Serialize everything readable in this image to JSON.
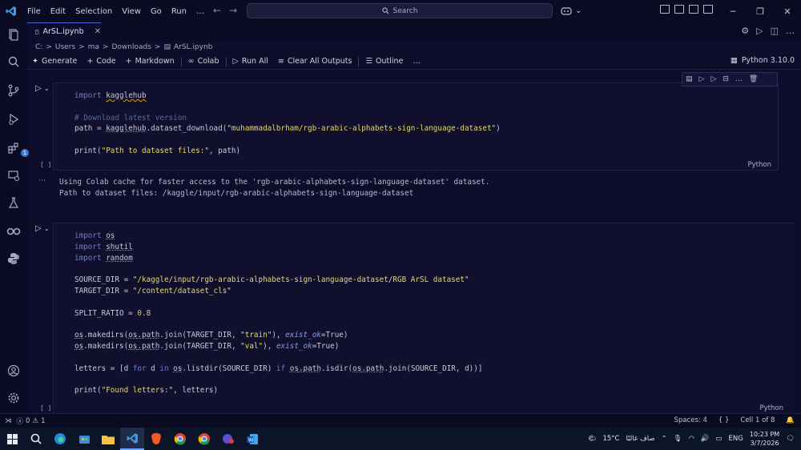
{
  "menu": [
    "File",
    "Edit",
    "Selection",
    "View",
    "Go",
    "Run",
    "…"
  ],
  "search": {
    "label": "Search"
  },
  "tab": {
    "title": "ArSL.ipynb"
  },
  "breadcrumb": [
    "C:",
    ">",
    "Users",
    ">",
    "ma",
    ">",
    "Downloads",
    ">",
    "ArSL.ipynb"
  ],
  "toolbar": {
    "generate": "Generate",
    "code": "Code",
    "markdown": "Markdown",
    "colab": "Colab",
    "run_all": "Run All",
    "clear_outputs": "Clear All Outputs",
    "outline": "Outline",
    "more": "…",
    "kernel": "Python 3.10.0"
  },
  "cell1": {
    "exec": "[ ]",
    "lang": "Python",
    "lines": {
      "l1_kw": "import",
      "l1_mod": "kagglehub",
      "l3": "# Download latest version",
      "l4_pre": "path = ",
      "l4_mod": "kagglehub",
      "l4_fn": ".dataset_download(",
      "l4_str": "\"muhammadalbrham/rgb-arabic-alphabets-sign-language-dataset\"",
      "l4_end": ")",
      "l6_fn": "print(",
      "l6_str": "\"Path to dataset files:\"",
      "l6_end": ", path)"
    }
  },
  "output1": {
    "line1": "Using Colab cache for faster access to the 'rgb-arabic-alphabets-sign-language-dataset' dataset.",
    "line2": "Path to dataset files: /kaggle/input/rgb-arabic-alphabets-sign-language-dataset"
  },
  "cell2": {
    "exec": "[ ]",
    "lang": "Python",
    "lines": {
      "i1": "os",
      "i2": "shutil",
      "i3": "random",
      "kw": "import",
      "src_pre": "SOURCE_DIR = ",
      "src_str": "\"/kaggle/input/rgb-arabic-alphabets-sign-language-dataset/RGB ArSL dataset\"",
      "tgt_pre": "TARGET_DIR = ",
      "tgt_str": "\"/content/dataset_cls\"",
      "split_pre": "SPLIT_RATIO = ",
      "split_num": "0.8",
      "mk1_os": "os",
      "mk1_mid": ".makedirs(",
      "mk1_os2": "os",
      "mk1_path": ".path",
      "mk1_join": ".join(TARGET_DIR, ",
      "mk1_str": "\"train\"",
      "mk1_sep": "), ",
      "mk1_kw": "exist_ok",
      "mk1_end": "=True)",
      "mk2_str": "\"val\"",
      "let_pre": "letters = [d ",
      "let_for": "for",
      "let_d": " d ",
      "let_in": "in",
      "let_sp": " ",
      "let_os": "os",
      "let_list": ".listdir(SOURCE_DIR) ",
      "let_if": "if",
      "let_sp2": " ",
      "let_os2": "os",
      "let_path": ".path",
      "let_isdir": ".isdir(",
      "let_os3": "os",
      "let_path2": ".path",
      "let_join": ".join(SOURCE_DIR, d))]",
      "pr_fn": "print(",
      "pr_str": "\"Found letters:\"",
      "pr_end": ", letters)"
    }
  },
  "status": {
    "errors": "0",
    "warnings": "1",
    "spaces": "Spaces: 4",
    "braces": "{ }",
    "cell": "Cell 1 of 8"
  },
  "taskbar": {
    "weather": "15°C",
    "weather_text": "صاف غالبًا",
    "lang": "ENG",
    "time": "10:23 PM",
    "date": "3/7/2026"
  }
}
